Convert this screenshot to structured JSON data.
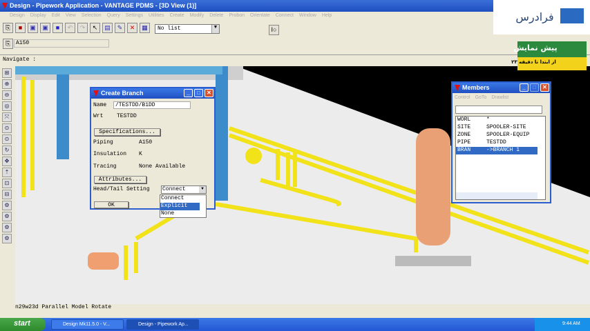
{
  "window": {
    "title": "Design - Pipework Application - VANTAGE PDMS - [3D View (1)]"
  },
  "menu": [
    "Design",
    "Display",
    "Edit",
    "View",
    "Selection",
    "Query",
    "Settings",
    "Utilities",
    "Create",
    "Modify",
    "Delete",
    "Probon",
    "Orientate",
    "Connect",
    "Window",
    "Help"
  ],
  "toolbar": {
    "list_select": "No list",
    "spec_field": "A150"
  },
  "navigate_label": "Navigate :",
  "status_text": "n29w23d Parallel Model Rotate",
  "create_branch": {
    "title": "Create Branch",
    "name_label": "Name",
    "name_value": "/TESTDD/B1DD",
    "wrt_label": "Wrt",
    "wrt_value": "TESTDD",
    "specifications_button": "Specifications...",
    "piping_label": "Piping",
    "piping_value": "A150",
    "insulation_label": "Insulation",
    "insulation_value": "K",
    "tracing_label": "Tracing",
    "tracing_value": "None Available",
    "attributes_button": "Attributes...",
    "headtail_label": "Head/Tail Setting",
    "headtail_value": "Connect",
    "headtail_options": [
      "Connect",
      "Explicit",
      "None"
    ],
    "headtail_highlighted": "Explicit",
    "ok_button": "OK"
  },
  "members": {
    "title": "Members",
    "menu": [
      "Control",
      "GoTo",
      "Drawlist"
    ],
    "rows": [
      [
        "WORL",
        "*"
      ],
      [
        "SITE",
        "SPOOLER-SITE"
      ],
      [
        "ZONE",
        "SPOOLER-EQUIP"
      ],
      [
        "PIPE",
        "TESTDD"
      ],
      [
        "BRAN",
        "->BRANCH 1"
      ]
    ],
    "selected_index": 4
  },
  "taskbar": {
    "start": "start",
    "tasks": [
      "Design Mk11.5.0 - V...",
      "Design - Pipework Ap..."
    ],
    "clock": "9:44 AM"
  },
  "watermark": {
    "brand": "فرادرس",
    "preview": "پیش نمایش",
    "range": "از ابتدا تا دقیقه ۲۳"
  },
  "colors": {
    "titlebar": "#2a5ed0",
    "pipe": "#f2e21a",
    "steel": "#3c8ccc",
    "vessel": "#e8a074",
    "selection": "#316ac5"
  }
}
